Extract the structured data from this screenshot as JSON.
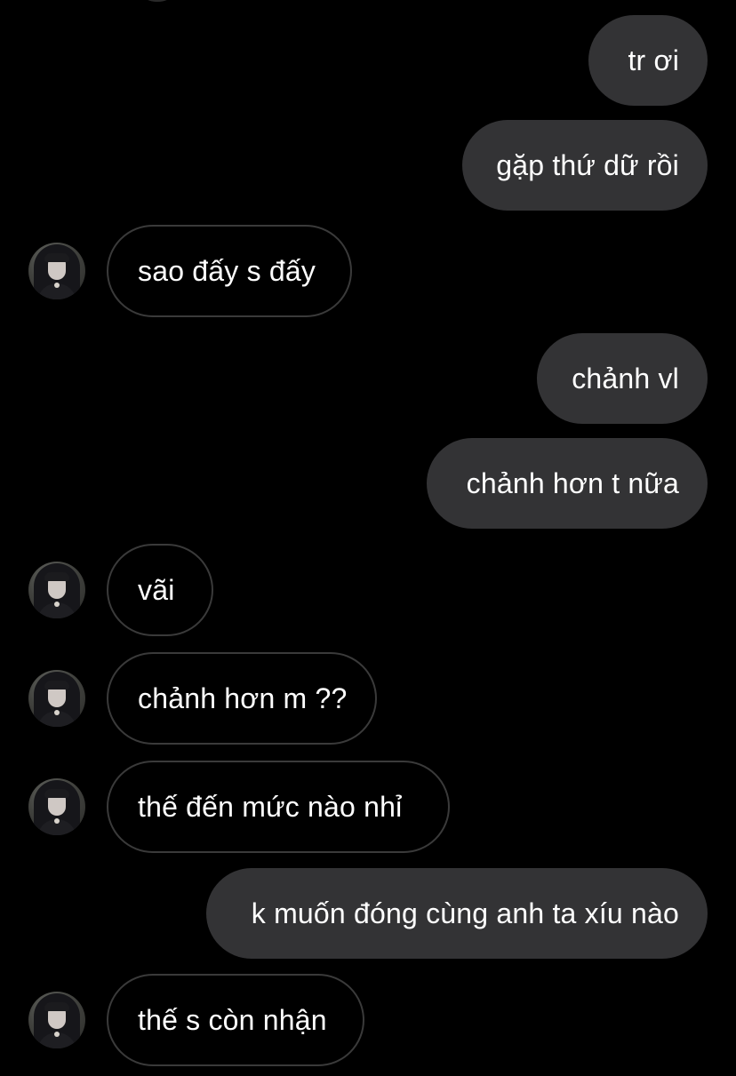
{
  "conversation": {
    "messages": [
      {
        "direction": "sent",
        "text": "tr ơi"
      },
      {
        "direction": "sent",
        "text": "gặp thứ dữ rồi"
      },
      {
        "direction": "received",
        "text": "sao đấy s đấy",
        "avatar": "contact-avatar"
      },
      {
        "direction": "sent",
        "text": "chảnh vl"
      },
      {
        "direction": "sent",
        "text": "chảnh hơn t nữa"
      },
      {
        "direction": "received",
        "text": "vãi",
        "avatar": "contact-avatar"
      },
      {
        "direction": "received",
        "text": "chảnh hơn m ??",
        "avatar": "contact-avatar"
      },
      {
        "direction": "received",
        "text": "thế đến mức nào nhỉ",
        "avatar": "contact-avatar"
      },
      {
        "direction": "sent",
        "text": "k muốn đóng cùng anh ta xíu nào"
      },
      {
        "direction": "received",
        "text": "thế s còn nhận",
        "avatar": "contact-avatar"
      }
    ]
  },
  "colors": {
    "background": "#000000",
    "sent_bubble": "#333335",
    "received_bubble_border": "#3a3a3a",
    "text": "#ffffff"
  }
}
